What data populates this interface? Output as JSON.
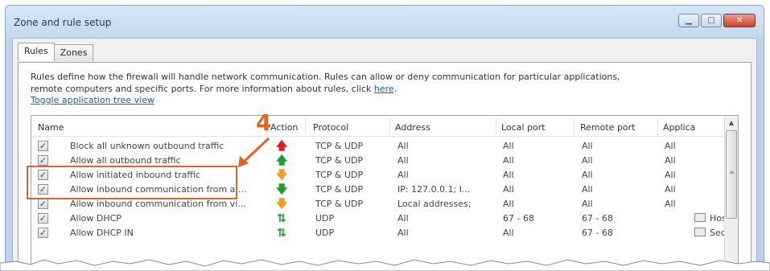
{
  "window": {
    "title": "Zone and rule setup"
  },
  "tabs": [
    {
      "label": "Rules"
    },
    {
      "label": "Zones"
    }
  ],
  "description": {
    "line1": "Rules define how the firewall will handle network communication. Rules can allow or deny communication for particular applications,",
    "line2_prefix": "remote computers and specific ports. For more information about rules, click ",
    "link": "here",
    "line2_suffix": "."
  },
  "toggle_link": "Toggle application tree view",
  "table": {
    "columns": [
      "Name",
      "Action",
      "Protocol",
      "Address",
      "Local port",
      "Remote port",
      "Applica"
    ],
    "rows": [
      {
        "name": "Block all unknown outbound traffic",
        "action": "red-up-arrow-icon",
        "protocol": "TCP & UDP",
        "address": "All",
        "local": "All",
        "remote": "All",
        "app": "All"
      },
      {
        "name": "Allow all outbound traffic",
        "action": "green-up-arrow-icon",
        "protocol": "TCP & UDP",
        "address": "All",
        "local": "All",
        "remote": "All",
        "app": "All"
      },
      {
        "name": "Allow initiated inbound traffic",
        "action": "orange-down-arrow-icon",
        "protocol": "TCP & UDP",
        "address": "All",
        "local": "All",
        "remote": "All",
        "app": "All"
      },
      {
        "name": "Allow inbound communication from a ...",
        "action": "green-down-arrow-icon",
        "protocol": "TCP & UDP",
        "address": "IP: 127.0.0.1; I...",
        "local": "All",
        "remote": "All",
        "app": "All"
      },
      {
        "name": "Allow inbound communication from vi...",
        "action": "orange-down-arrow-icon",
        "protocol": "TCP & UDP",
        "address": "Local addresses;",
        "local": "All",
        "remote": "All",
        "app": "All"
      },
      {
        "name": "Allow DHCP",
        "action": "green-bidirectional-arrow-icon",
        "protocol": "UDP",
        "address": "All",
        "local": "67 - 68",
        "remote": "67 - 68",
        "app": "Hos"
      },
      {
        "name": "Allow DHCP IN",
        "action": "green-bidirectional-arrow-icon",
        "protocol": "UDP",
        "address": "All",
        "local": "All",
        "remote": "67 - 68",
        "app": "Sec"
      }
    ]
  },
  "annotation": {
    "label": "4"
  },
  "colors": {
    "highlight": "#e0642a",
    "link": "#1a5fb4"
  }
}
